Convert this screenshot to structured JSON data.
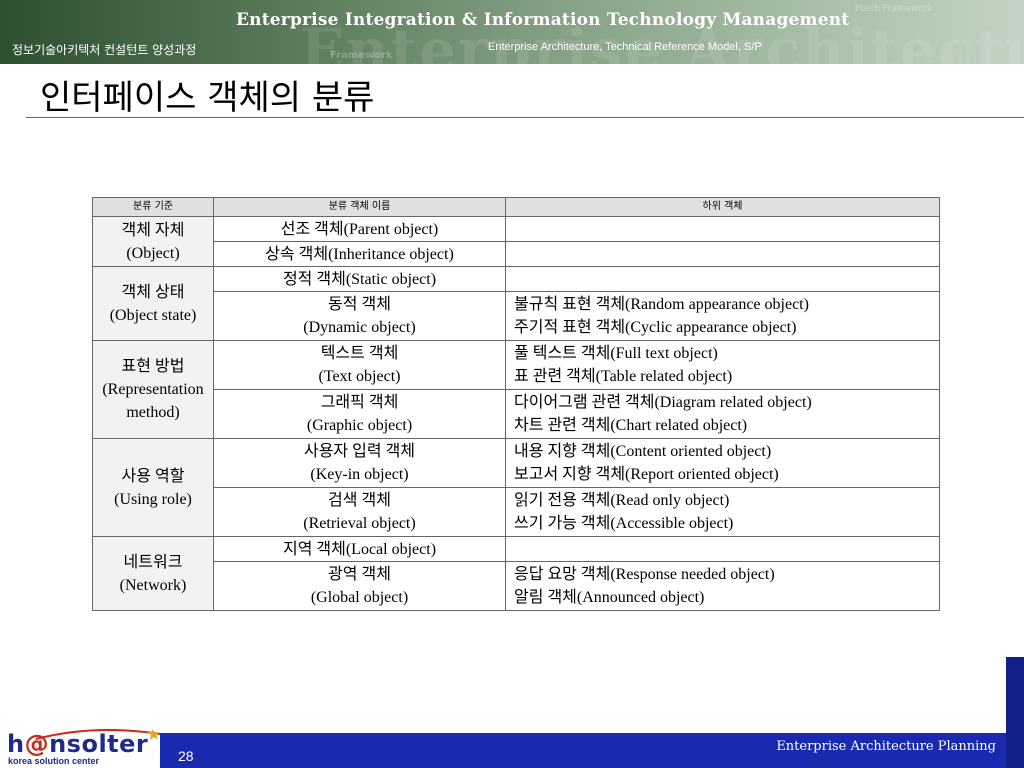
{
  "header": {
    "banner_title": "Enterprise Integration & Information Technology Management",
    "course": "정보기술아키텍처 컨설턴트 양성과정",
    "subtitle": "Enterprise Architecture, Technical Reference Model, S/P",
    "ghost_text": "Enterprise Architecture Model",
    "ghost_small": "Framework",
    "ghost_small2": "Ptech Framework"
  },
  "page_title": "인터페이스 객체의 분류",
  "table": {
    "headers": [
      "분류 기준",
      "분류 객체 이름",
      "하위 객체"
    ],
    "groups": [
      {
        "criterion": [
          "객체 자체",
          "(Object)"
        ],
        "rows": [
          {
            "object": [
              "선조 객체(Parent object)"
            ],
            "sub": []
          },
          {
            "object": [
              "상속 객체(Inheritance object)"
            ],
            "sub": []
          }
        ]
      },
      {
        "criterion": [
          "객체 상태",
          "(Object state)"
        ],
        "rows": [
          {
            "object": [
              "정적 객체(Static object)"
            ],
            "sub": []
          },
          {
            "object": [
              "동적 객체",
              "(Dynamic object)"
            ],
            "sub": [
              "불규칙 표현 객체(Random appearance object)",
              "주기적 표현 객체(Cyclic appearance object)"
            ]
          }
        ]
      },
      {
        "criterion": [
          "표현 방법",
          "(Representation method)"
        ],
        "rows": [
          {
            "object": [
              "텍스트 객체",
              "(Text object)"
            ],
            "sub": [
              "풀 텍스트 객체(Full text object)",
              "표 관련 객체(Table related object)"
            ]
          },
          {
            "object": [
              "그래픽 객체",
              "(Graphic object)"
            ],
            "sub": [
              "다이어그램 관련 객체(Diagram related object)",
              "차트 관련 객체(Chart related object)"
            ]
          }
        ]
      },
      {
        "criterion": [
          "사용 역할",
          "(Using role)"
        ],
        "rows": [
          {
            "object": [
              "사용자 입력 객체",
              "(Key-in object)"
            ],
            "sub": [
              "내용 지향 객체(Content oriented object)",
              "보고서 지향 객체(Report oriented object)"
            ]
          },
          {
            "object": [
              "검색 객체",
              "(Retrieval object)"
            ],
            "sub": [
              "읽기 전용 객체(Read only object)",
              "쓰기 가능 객체(Accessible object)"
            ]
          }
        ]
      },
      {
        "criterion": [
          "네트워크",
          "(Network)"
        ],
        "rows": [
          {
            "object": [
              "지역 객체(Local object)"
            ],
            "sub": []
          },
          {
            "object": [
              "광역 객체",
              "(Global object)"
            ],
            "sub": [
              "응답 요망 객체(Response needed object)",
              "알림 객체(Announced object)"
            ]
          }
        ]
      }
    ]
  },
  "footer": {
    "page_number": "28",
    "text": "Enterprise Architecture Planning",
    "logo_brand_prefix": "h",
    "logo_brand_at": "@",
    "logo_brand_suffix": "nsolter",
    "logo_tagline": "korea solution center"
  },
  "colors": {
    "footer_bar": "#1a2ab0",
    "title_rule": "#4f6c9c",
    "banner_dark": "#2f4f31",
    "header_cell": "#e0e0e0",
    "criterion_cell": "#f2f2f2"
  }
}
